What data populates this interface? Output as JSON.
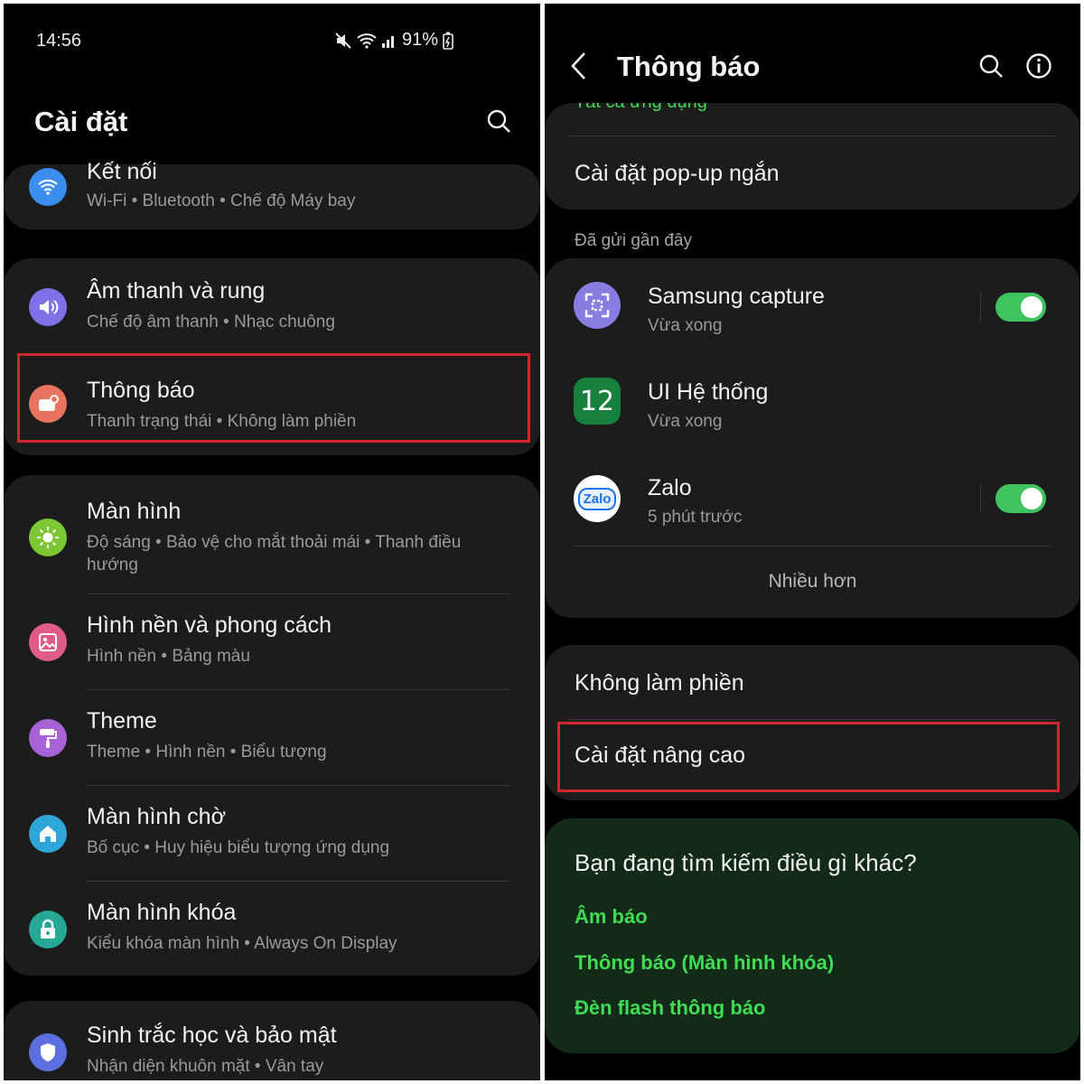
{
  "left": {
    "status": {
      "time": "14:56",
      "battery": "91%"
    },
    "title": "Cài đặt",
    "items": [
      {
        "title": "Kết nối",
        "subtitle": "Wi-Fi  •  Bluetooth  •  Chế độ Máy bay",
        "icon": "wifi-icon",
        "color": "#3b8df0"
      },
      {
        "title": "Âm thanh và rung",
        "subtitle": "Chế độ âm thanh  •  Nhạc chuông",
        "icon": "speaker-icon",
        "color": "#7f72e8"
      },
      {
        "title": "Thông báo",
        "subtitle": "Thanh trạng thái  •  Không làm phiền",
        "icon": "notification-icon",
        "color": "#e8735f"
      },
      {
        "title": "Màn hình",
        "subtitle": "Độ sáng  •  Bảo vệ cho mắt thoải mái  •  Thanh điều hướng",
        "icon": "sun-icon",
        "color": "#7ec734"
      },
      {
        "title": "Hình nền và phong cách",
        "subtitle": "Hình nền  •  Bảng màu",
        "icon": "image-icon",
        "color": "#e05c87"
      },
      {
        "title": "Theme",
        "subtitle": "Theme  •  Hình nền  •  Biểu tượng",
        "icon": "paint-roller-icon",
        "color": "#a762d6"
      },
      {
        "title": "Màn hình chờ",
        "subtitle": "Bố cục  •  Huy hiệu biểu tượng ứng dụng",
        "icon": "home-icon",
        "color": "#2fa6d8"
      },
      {
        "title": "Màn hình khóa",
        "subtitle": "Kiểu khóa màn hình  •  Always On Display",
        "icon": "lock-icon",
        "color": "#26a896"
      },
      {
        "title": "Sinh trắc học và bảo mật",
        "subtitle": "Nhận diện khuôn mặt  •  Vân tay",
        "icon": "shield-icon",
        "color": "#5b6fe0"
      }
    ]
  },
  "right": {
    "title": "Thông báo",
    "top_partial": "Tất cả ứng dụng",
    "popup": "Cài đặt pop-up ngắn",
    "recent_label": "Đã gửi gần đây",
    "apps": [
      {
        "name": "Samsung capture",
        "time": "Vừa xong",
        "icon": "samsung-capture-icon",
        "toggle": true
      },
      {
        "name": "UI Hệ thống",
        "time": "Vừa xong",
        "icon": "one-ui-icon",
        "toggle": false
      },
      {
        "name": "Zalo",
        "time": "5 phút trước",
        "icon": "zalo-icon",
        "toggle": true
      }
    ],
    "zalo_logo": "Zalo",
    "oneui_logo": "12",
    "more": "Nhiều hơn",
    "dnd": "Không làm phiền",
    "advanced": "Cài đặt nâng cao",
    "suggest": {
      "title": "Bạn đang tìm kiếm điều gì khác?",
      "links": [
        "Âm báo",
        "Thông báo (Màn hình khóa)",
        "Đèn flash thông báo"
      ]
    }
  },
  "colors": {
    "accent_green": "#3fdc54",
    "toggle_on": "#3ec45e",
    "highlight_box": "#d3262c"
  }
}
